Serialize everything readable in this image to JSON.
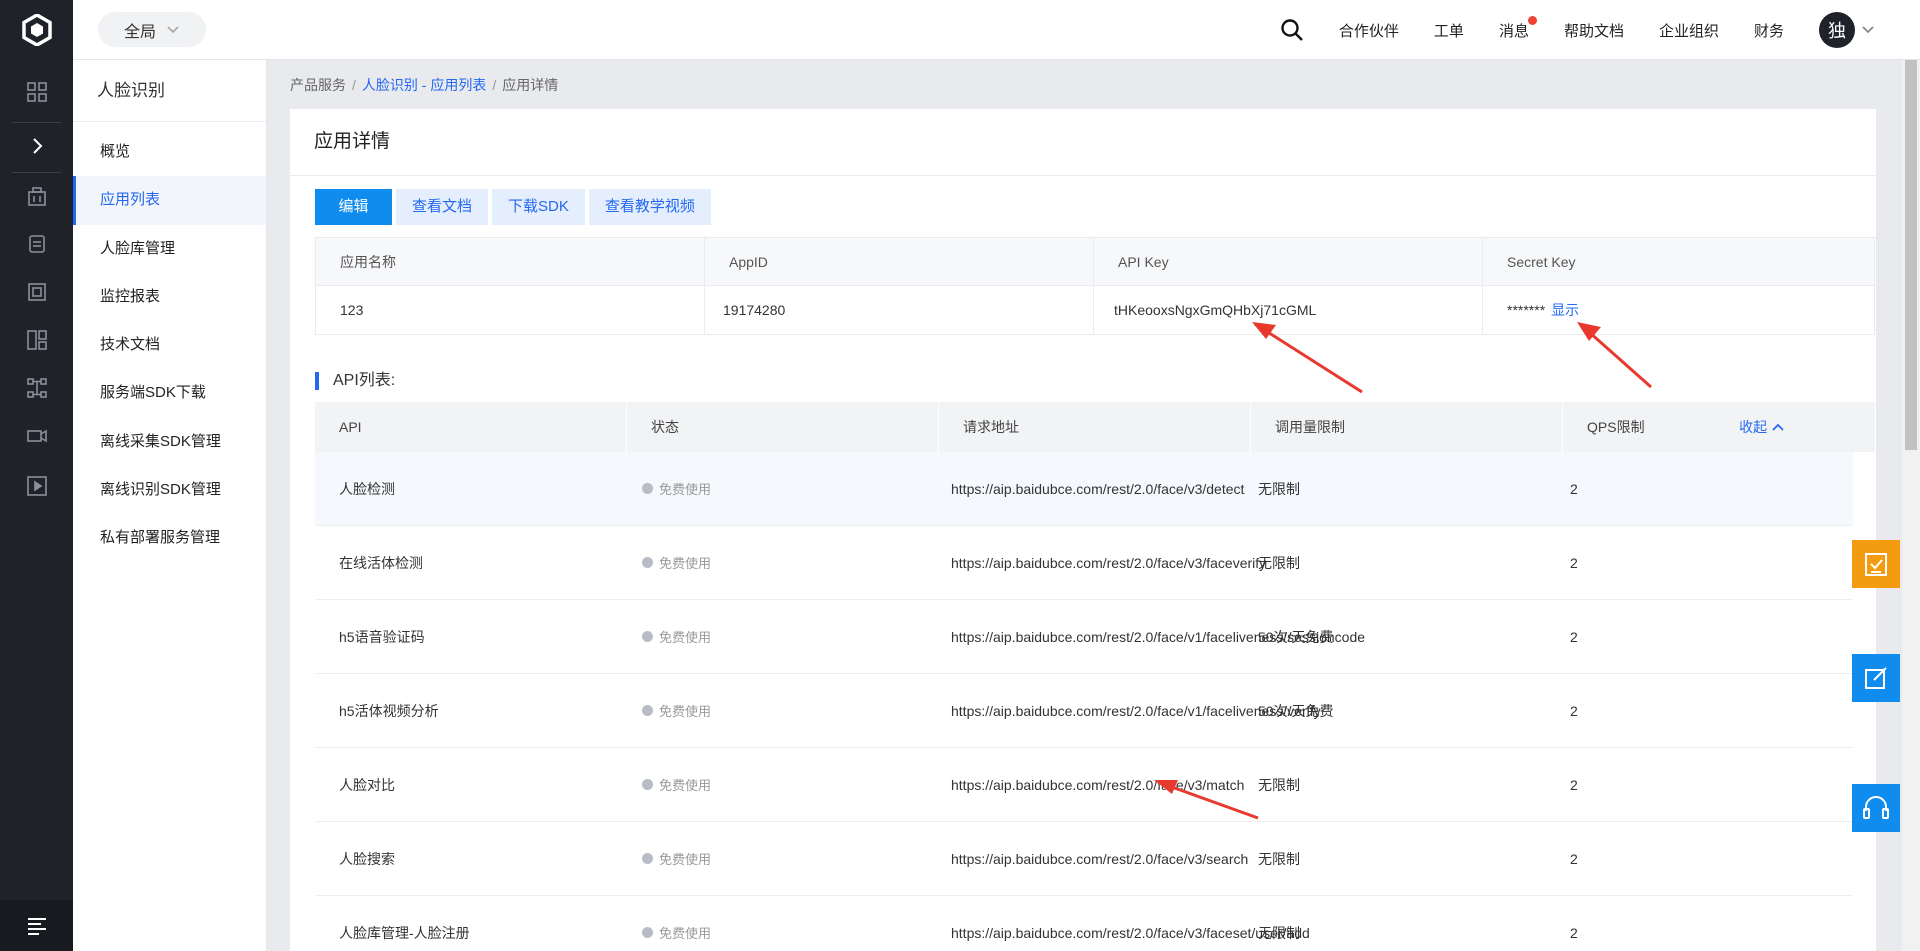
{
  "topbar": {
    "scope": "全局",
    "nav": [
      "合作伙伴",
      "工单",
      "消息",
      "帮助文档",
      "企业组织",
      "财务"
    ],
    "avatar": "独"
  },
  "sidebar": {
    "title": "人脸识别",
    "items": [
      "概览",
      "应用列表",
      "人脸库管理",
      "监控报表",
      "技术文档",
      "服务端SDK下载",
      "离线采集SDK管理",
      "离线识别SDK管理",
      "私有部署服务管理"
    ],
    "active_index": 1
  },
  "breadcrumb": {
    "root": "产品服务",
    "sep": "/",
    "link": "人脸识别 - 应用列表",
    "current": "应用详情"
  },
  "page": {
    "title": "应用详情",
    "tabs": [
      "编辑",
      "查看文档",
      "下载SDK",
      "查看教学视频"
    ]
  },
  "app_info": {
    "headers": [
      "应用名称",
      "AppID",
      "API Key",
      "Secret Key"
    ],
    "name": "123",
    "app_id": "19174280",
    "api_key": "tHKeooxsNgxGmQHbXj71cGML",
    "secret_masked": "*******",
    "show_label": "显示"
  },
  "api_section": {
    "label": "API列表:",
    "headers": [
      "API",
      "状态",
      "请求地址",
      "调用量限制",
      "QPS限制"
    ],
    "collapse_label": "收起",
    "rows": [
      {
        "api": "人脸检测",
        "status": "免费使用",
        "url": "https://aip.baidubce.com/rest/2.0/face/v3/detect",
        "limit": "无限制",
        "qps": "2"
      },
      {
        "api": "在线活体检测",
        "status": "免费使用",
        "url": "https://aip.baidubce.com/rest/2.0/face/v3/faceverify",
        "limit": "无限制",
        "qps": "2"
      },
      {
        "api": "h5语音验证码",
        "status": "免费使用",
        "url": "https://aip.baidubce.com/rest/2.0/face/v1/faceliveness/sessioncode",
        "limit": "50次/天免费",
        "qps": "2"
      },
      {
        "api": "h5活体视频分析",
        "status": "免费使用",
        "url": "https://aip.baidubce.com/rest/2.0/face/v1/faceliveness/verify",
        "limit": "50次/天免费",
        "qps": "2"
      },
      {
        "api": "人脸对比",
        "status": "免费使用",
        "url": "https://aip.baidubce.com/rest/2.0/face/v3/match",
        "limit": "无限制",
        "qps": "2"
      },
      {
        "api": "人脸搜索",
        "status": "免费使用",
        "url": "https://aip.baidubce.com/rest/2.0/face/v3/search",
        "limit": "无限制",
        "qps": "2"
      },
      {
        "api": "人脸库管理-人脸注册",
        "status": "免费使用",
        "url": "https://aip.baidubce.com/rest/2.0/face/v3/faceset/user/add",
        "limit": "无限制",
        "qps": "2"
      }
    ]
  },
  "colors": {
    "accent": "#2468f2",
    "primary_button": "#108cee",
    "rail": "#1f2229",
    "float_orange": "#f39c12",
    "float_blue": "#108cee",
    "annotation_arrow": "#e8392f"
  },
  "icons": {
    "rail": [
      "grid-icon",
      "chevron-right-icon",
      "building-icon",
      "database-icon",
      "doc-icon",
      "dashboard-icon",
      "network-icon",
      "video-icon",
      "play-icon"
    ],
    "floating": [
      "checklist-icon",
      "edit-icon",
      "headset-icon"
    ]
  }
}
